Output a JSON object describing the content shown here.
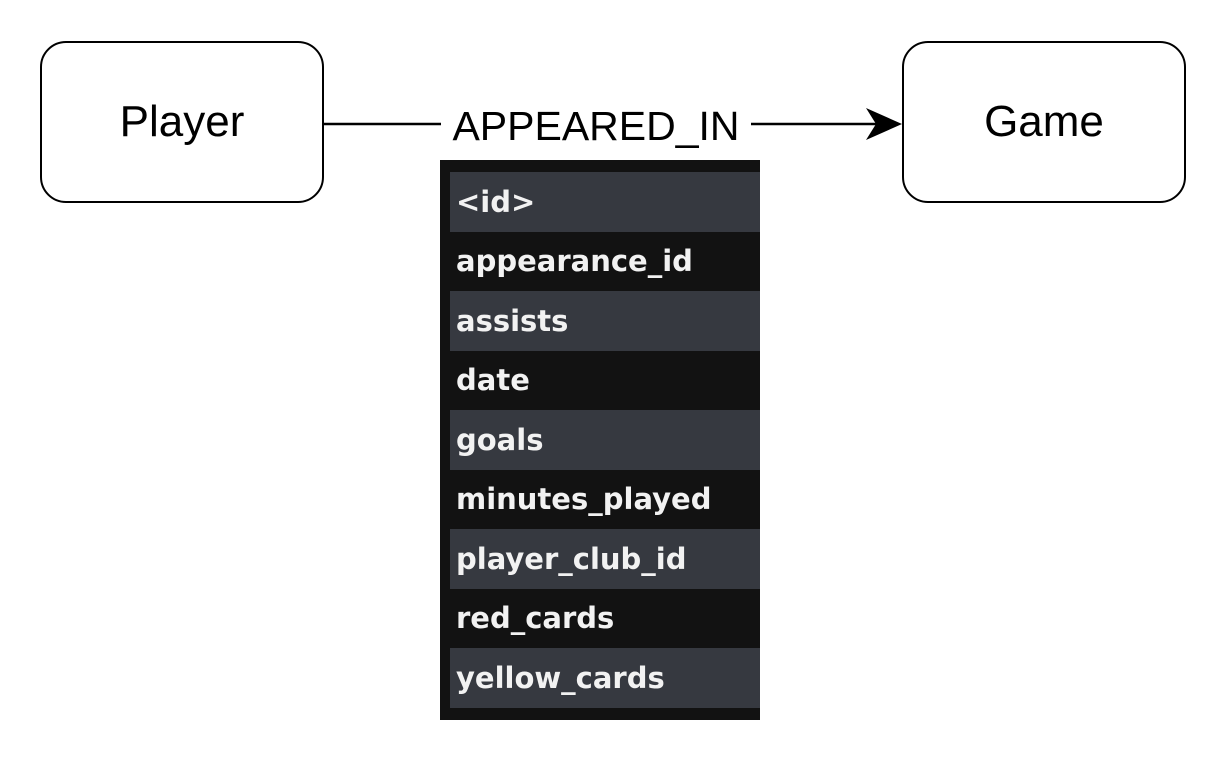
{
  "nodes": {
    "source": {
      "label": "Player"
    },
    "target": {
      "label": "Game"
    }
  },
  "relationship": {
    "type": "APPEARED_IN",
    "properties": [
      "<id>",
      "appearance_id",
      "assists",
      "date",
      "goals",
      "minutes_played",
      "player_club_id",
      "red_cards",
      "yellow_cards"
    ]
  },
  "colors": {
    "panel_background": "#121212",
    "panel_row_alt": "#363940",
    "panel_text": "#f2f2f2",
    "stroke": "#000000"
  }
}
